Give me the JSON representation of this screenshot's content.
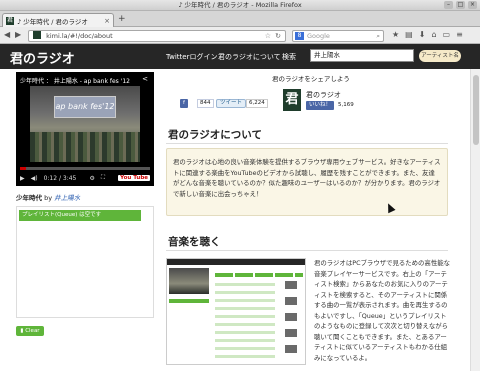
{
  "window": {
    "title": "♪ 少年時代 / 君のラジオ - Mozilla Firefox"
  },
  "tab": {
    "label": "♪ 少年時代 / 君のラジオ",
    "close": "×",
    "new_tab": "+"
  },
  "nav": {
    "url": "kimi.la/#!/doc/about",
    "search_placeholder": "Google",
    "back": "◀",
    "forward": "▶"
  },
  "header": {
    "logo": "君のラジオ",
    "twitter_login": "Twitterログイン",
    "about": "君のラジオについて",
    "search_label": "検索",
    "search_value": "井上陽水",
    "artist_button": "アーティスト名"
  },
  "player": {
    "title": "少年時代 ： 井上陽水 - ap bank fes '12",
    "stage_text": "ap bank fes'12",
    "time": "0:12 / 3:45",
    "yt_logo": "You Tube"
  },
  "now_playing": {
    "song": "少年時代",
    "by": "by",
    "artist": "井上陽水"
  },
  "playlist": {
    "button": "プレイリスト(Queue) は空です",
    "clear": "Clear"
  },
  "share": {
    "title": "君のラジオをシェアしよう",
    "fb_label": "f",
    "fb_count": "844",
    "tweet_label": "ツイート",
    "tweet_count": "6,224",
    "icon_char": "君",
    "site_name": "君のラジオ",
    "like_label": "いいね！",
    "like_count": "5,169"
  },
  "about": {
    "heading": "君のラジオについて",
    "body": "君のラジオは心地の良い音楽体験を提供するブラウザ専用ウェブサービス。好きなアーティストに関連する楽曲をYouTubeのビデオから試聴し、履歴を残すことができます。また、友達がどんな音楽を聴いているのか？似た趣味のユーザーはいるのか？が分かります。君のラジオで新しい音楽に出会っちゃえ！"
  },
  "music": {
    "heading": "音楽を聴く",
    "body": "君のラジオはPCブラウザで見るための高性能な音楽プレイヤーサービスです。右上の「アーティスト検索」からあなたのお気に入りのアーティストを検索すると、そのアーティストに関係する曲の一覧が表示されます。曲を再生するのもよいですし、「Queue」というプレイリストのようなものに登録して次次と切り替えながら聴いて聞くこともできます。また、とあるアーティストに似ているアーティストもわかる仕組みになっているよ。"
  }
}
